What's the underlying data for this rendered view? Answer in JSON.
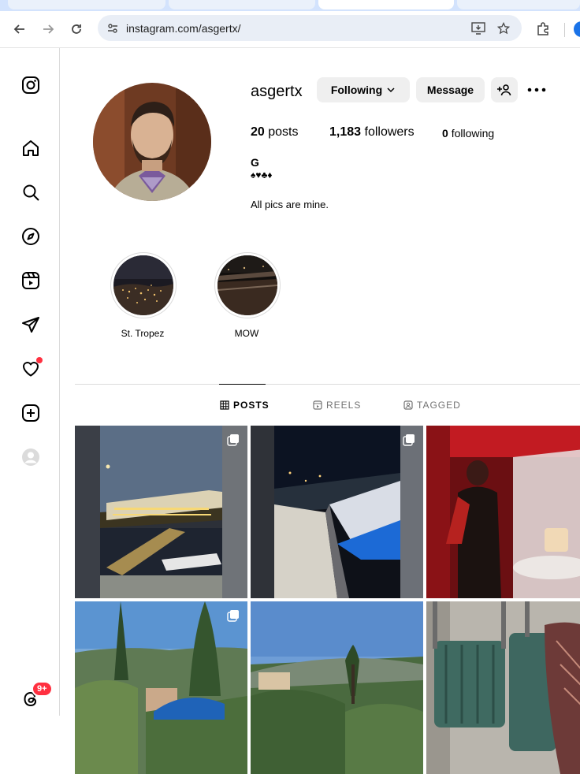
{
  "browser": {
    "url": "instagram.com/asgertx/"
  },
  "sidebar": {
    "items": [
      {
        "name": "instagram-logo-icon"
      },
      {
        "name": "home-icon"
      },
      {
        "name": "search-icon"
      },
      {
        "name": "explore-icon"
      },
      {
        "name": "reels-icon"
      },
      {
        "name": "messages-icon"
      },
      {
        "name": "notifications-icon"
      },
      {
        "name": "create-icon"
      },
      {
        "name": "profile-icon"
      },
      {
        "name": "threads-icon"
      }
    ],
    "threads_badge": "9+"
  },
  "profile": {
    "username": "asgertx",
    "following_button": "Following",
    "message_button": "Message",
    "posts_count": "20",
    "posts_label": "posts",
    "followers_count": "1,183",
    "followers_label": "followers",
    "following_count": "0",
    "following_label": "following",
    "bio_name": "G",
    "bio_suits": "♠♥♣♦",
    "bio_text": "All pics are mine."
  },
  "highlights": [
    {
      "label": "St. Tropez"
    },
    {
      "label": "MOW"
    }
  ],
  "tabs": [
    {
      "label": "POSTS",
      "active": true
    },
    {
      "label": "REELS",
      "active": false
    },
    {
      "label": "TAGGED",
      "active": false
    }
  ],
  "colors": {
    "accent_blue": "#0095f6",
    "badge_red": "#ff3040",
    "button_gray": "#efefef"
  }
}
